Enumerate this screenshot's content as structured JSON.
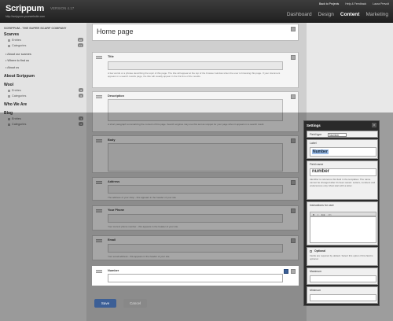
{
  "app": {
    "brand": "Scrippum",
    "version": "VERSION 4.17",
    "url": "http://scrippum.yourwebsite.com"
  },
  "toplinks": {
    "back": "Back to Projects",
    "help": "Help & Feedback",
    "user": "Laura Prevolt"
  },
  "nav": {
    "items": [
      "Dashboard",
      "Design",
      "Content",
      "Marketing"
    ],
    "active": "Content"
  },
  "sidebar": {
    "site": "SCRIPPUM - THE SUPER SCARF COMPANY",
    "scarves": "Scarves",
    "scarves_entries": "Entries",
    "scarves_entries_count": "16",
    "scarves_categories": "Categories",
    "scarves_categories_count": "11",
    "about_scarves": "• About our scarves",
    "where": "• Where to find us",
    "about_us": "• About us",
    "about_scrippum": "About Scrippum",
    "wool": "Wool",
    "wool_entries": "Entries",
    "wool_entries_count": "8",
    "wool_categories": "Categories",
    "wool_categories_count": "6",
    "who": "Who We Are",
    "blog": "Blog",
    "blog_entries": "Entries",
    "blog_entries_count": "4",
    "blog_categories": "Categories",
    "blog_categories_count": "2"
  },
  "page": {
    "title": "Home page"
  },
  "fields": [
    {
      "label": "Title",
      "help": "A few words or a phrase describing the topic of this page. The title will appear at the top of the browser window when the user is browsing this page. If your document appears in a search results page, the title will usually appear in the first line of the results."
    },
    {
      "label": "Description",
      "help": "A short paragraph summarizing the content of this page. Search engines may use this text as snippet for your page when it appears in a search result."
    },
    {
      "label": "Body",
      "help": ""
    },
    {
      "label": "Address",
      "help": "The address of your shop - this appears in the header of your site"
    },
    {
      "label": "Your Phone",
      "help": "Your current phone number - this appears in the header of your site"
    },
    {
      "label": "Email",
      "help": "Your email address - this appears in the header of your site"
    },
    {
      "label": "Number",
      "help": ""
    }
  ],
  "buttons": {
    "save": "Save",
    "cancel": "Cancel"
  },
  "settings": {
    "title": "Settings",
    "close": "×",
    "field_type_label": "Field type",
    "field_type_value": "Number",
    "label_title": "Label",
    "label_value": "Number",
    "field_name_title": "Field name",
    "field_name_value": "number",
    "field_name_hint": "Identifier to reference this field in the templates. The name cannot be changed after it's been saved. Letters, numbers and underscores only. Must start with a letter.",
    "instructions_title": "Instructions for user",
    "toolbar": [
      "B",
      "I",
      "link",
      "</>"
    ],
    "optional_title": "Optional",
    "optional_hint": "Fields are required by default. Select this option if this field is optional.",
    "maximum_title": "Maximum",
    "minimum_title": "Minimum"
  },
  "colors": {
    "accent": "#3c5f96",
    "topbar": "#2b2b2b",
    "selection": "#9bbbe6"
  }
}
